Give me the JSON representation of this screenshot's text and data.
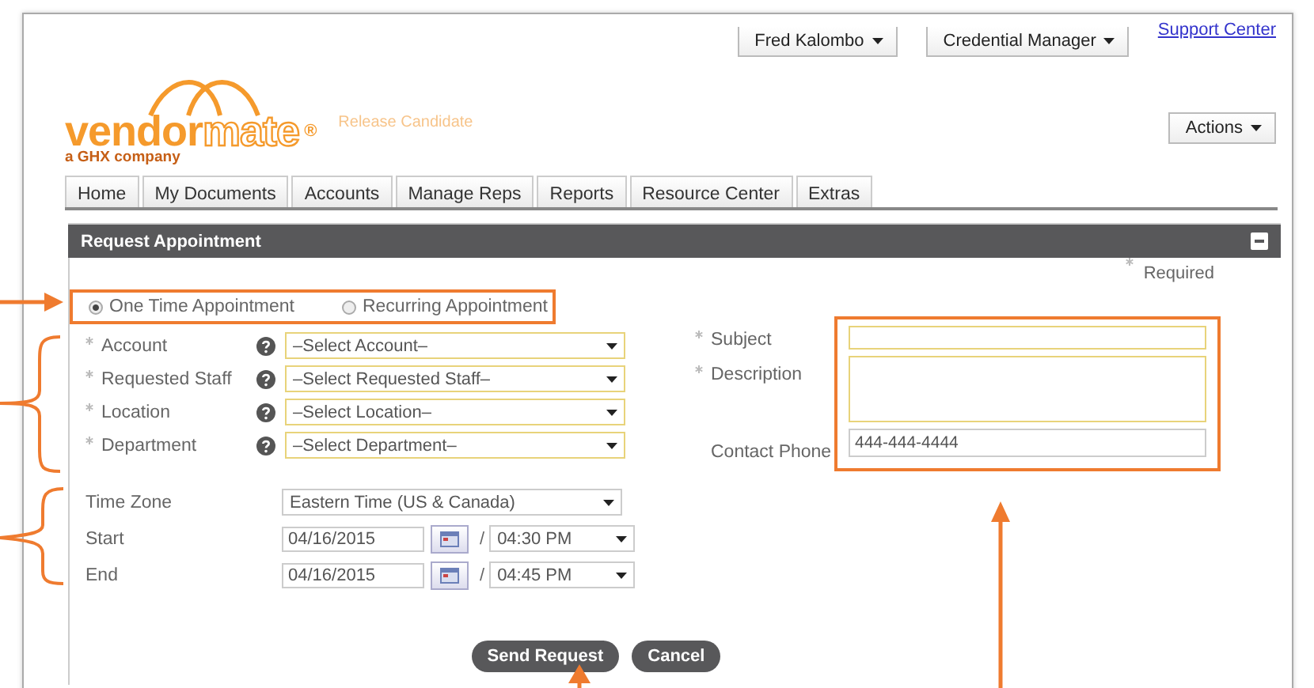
{
  "header": {
    "user_menu": "Fred Kalombo",
    "credential_menu": "Credential Manager",
    "support_link": "Support Center",
    "logo": {
      "word_a": "vendor",
      "word_b": "mate",
      "mark": "®",
      "tagline": "a GHX company"
    },
    "build_label": "Release Candidate",
    "actions_button": "Actions"
  },
  "tabs": [
    {
      "label": "Home",
      "selected": false
    },
    {
      "label": "My Documents",
      "selected": false
    },
    {
      "label": "Accounts",
      "selected": false
    },
    {
      "label": "Manage Reps",
      "selected": false
    },
    {
      "label": "Reports",
      "selected": false
    },
    {
      "label": "Resource Center",
      "selected": false
    },
    {
      "label": "Extras",
      "selected": false
    }
  ],
  "panel": {
    "title": "Request Appointment",
    "expanded": true,
    "required_note": "Required"
  },
  "appointment_type": [
    {
      "label": "One Time Appointment",
      "selected": true
    },
    {
      "label": "Recurring Appointment",
      "selected": false
    }
  ],
  "left_fields": [
    {
      "label": "Account",
      "required": true,
      "value": "–Select Account–"
    },
    {
      "label": "Requested Staff",
      "required": true,
      "value": "–Select Requested Staff–"
    },
    {
      "label": "Location",
      "required": true,
      "value": "–Select Location–"
    },
    {
      "label": "Department",
      "required": true,
      "value": "–Select Department–"
    }
  ],
  "right_fields": [
    {
      "label": "Subject",
      "required": true,
      "kind": "input"
    },
    {
      "label": "Description",
      "required": true,
      "kind": "textarea"
    },
    {
      "label": "Contact Phone",
      "required": false,
      "kind": "input",
      "value": "444-444-4444"
    }
  ],
  "schedule": {
    "time_zone_label": "Time Zone",
    "time_zone": "Eastern Time (US & Canada)",
    "rows": [
      {
        "label": "Start",
        "date": "04/16/2015",
        "separator": "/",
        "time": "04:30 PM"
      },
      {
        "label": "End",
        "date": "04/16/2015",
        "separator": "/",
        "time": "04:45 PM"
      }
    ]
  },
  "buttons": [
    {
      "label": "Send Request"
    },
    {
      "label": "Cancel"
    }
  ]
}
